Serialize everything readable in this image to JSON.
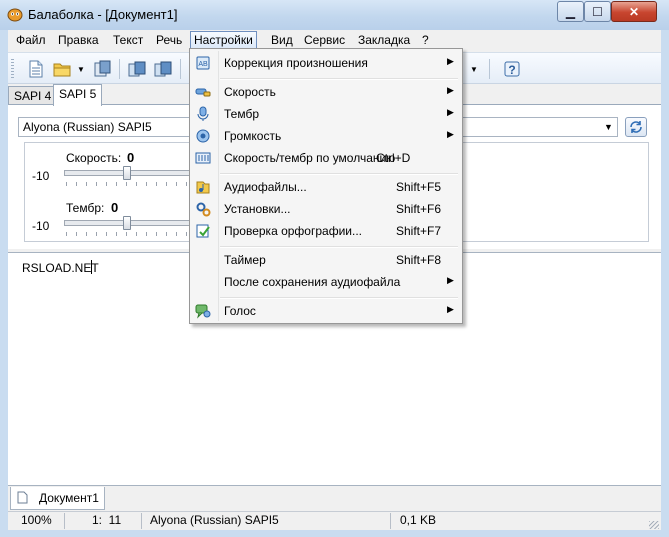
{
  "window": {
    "title": "Балаболка - [Документ1]"
  },
  "menubar": {
    "items": [
      "Файл",
      "Правка",
      "Текст",
      "Речь",
      "Настройки",
      "Вид",
      "Сервис",
      "Закладка",
      "?"
    ]
  },
  "tabs": {
    "sapi4": "SAPI 4",
    "sapi5": "SAPI 5"
  },
  "voice": {
    "selected": "Alyona (Russian) SAPI5"
  },
  "params": {
    "speed_label": "Скорость:",
    "speed_value": "0",
    "pitch_label": "Тембр:",
    "pitch_value": "0",
    "min_speed": "-10",
    "min_pitch": "-10",
    "speed_level": 0.5,
    "pitch_level": 0.5
  },
  "editor": {
    "text": "RSLOAD.NET"
  },
  "doc_tab": {
    "label": "Документ1"
  },
  "status": {
    "zoom": "100%",
    "position": "1:  11",
    "voice": "Alyona (Russian) SAPI5",
    "size": "0,1 KB"
  },
  "dropdown": {
    "items": [
      {
        "label": "Коррекция произношения",
        "shortcut": "",
        "submenu": true,
        "icon": "book-icon"
      },
      {
        "label": "Скорость",
        "shortcut": "",
        "submenu": true,
        "icon": "speed-icon"
      },
      {
        "label": "Тембр",
        "shortcut": "",
        "submenu": true,
        "icon": "microphone-icon"
      },
      {
        "label": "Громкость",
        "shortcut": "",
        "submenu": true,
        "icon": "volume-icon"
      },
      {
        "label": "Скорость/тембр по умолчанию",
        "shortcut": "Ctrl+D",
        "submenu": false,
        "icon": "equalizer-icon"
      },
      {
        "label": "Аудиофайлы...",
        "shortcut": "Shift+F5",
        "submenu": false,
        "icon": "audio-files-icon"
      },
      {
        "label": "Установки...",
        "shortcut": "Shift+F6",
        "submenu": false,
        "icon": "settings-icon"
      },
      {
        "label": "Проверка орфографии...",
        "shortcut": "Shift+F7",
        "submenu": false,
        "icon": "spellcheck-icon"
      },
      {
        "label": "Таймер",
        "shortcut": "Shift+F8",
        "submenu": false,
        "icon": ""
      },
      {
        "label": "После сохранения аудиофайла",
        "shortcut": "",
        "submenu": true,
        "icon": ""
      },
      {
        "label": "Голос",
        "shortcut": "",
        "submenu": true,
        "icon": "voice-icon"
      }
    ]
  },
  "colors": {
    "menu_highlight": "#dbe8f8",
    "title_bar": "#c2d7ee",
    "close_button": "#c8452f"
  }
}
